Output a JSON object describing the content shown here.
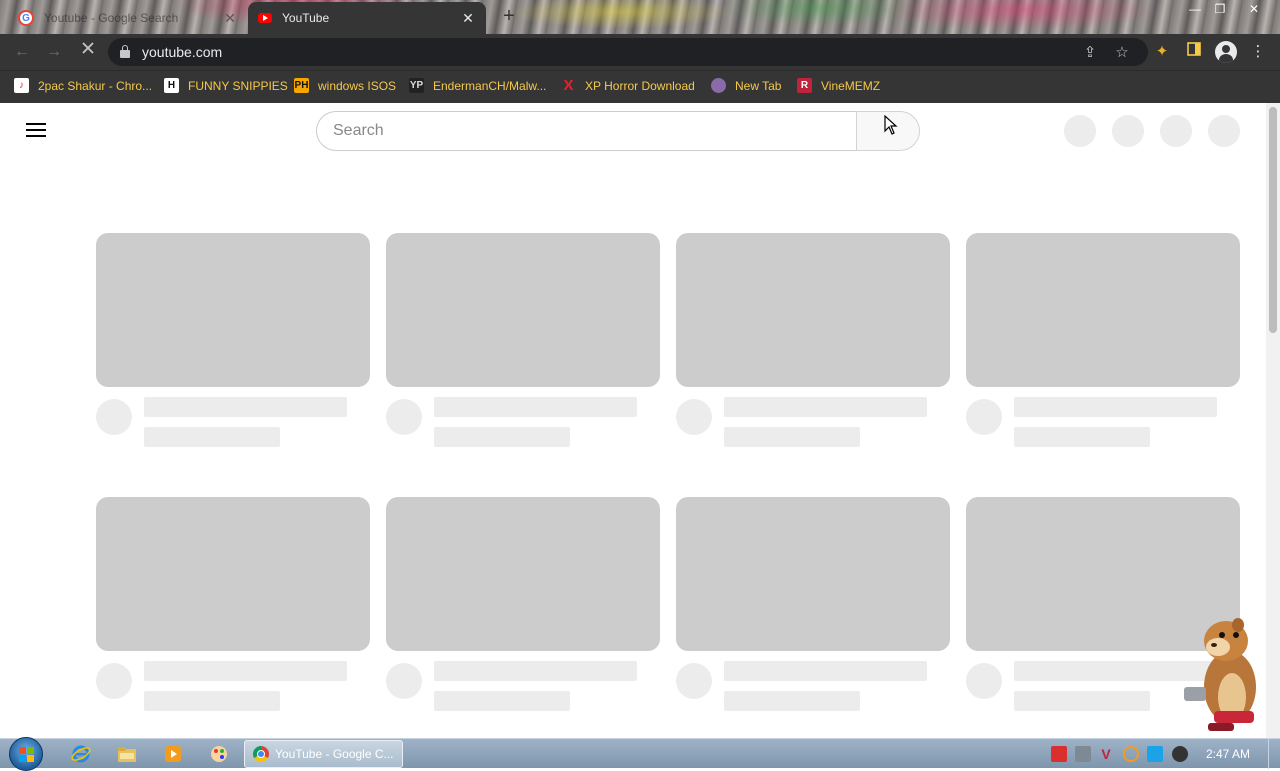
{
  "browser": {
    "tabs": [
      {
        "title": "Youtube - Google Search",
        "favicon": "google-icon",
        "active": false
      },
      {
        "title": "YouTube",
        "favicon": "youtube-icon",
        "active": true
      }
    ],
    "new_tab_symbol": "+",
    "close_symbol": "✕",
    "url": "youtube.com",
    "window_controls": {
      "minimize": "—",
      "maximize": "❐",
      "close": "✕"
    }
  },
  "bookmarks": [
    {
      "label": "2pac Shakur - Chro...",
      "icon": "music-icon",
      "color": "#d93025"
    },
    {
      "label": "FUNNY SNIPPIES",
      "icon": "h-letter-icon",
      "color": "#ffffff"
    },
    {
      "label": "windows ISOS",
      "icon": "ph-icon",
      "color": "#f7a600"
    },
    {
      "label": "EndermanCH/Malw...",
      "icon": "yp-icon",
      "color": "#444444"
    },
    {
      "label": "XP Horror Download",
      "icon": "x-icon",
      "color": "#e8212b"
    },
    {
      "label": "New Tab",
      "icon": "globe-icon",
      "color": "#8a6aa8"
    },
    {
      "label": "VineMEMZ",
      "icon": "r-icon",
      "color": "#c0243a"
    }
  ],
  "youtube": {
    "search_placeholder": "Search",
    "skeleton_rows": 2,
    "skeleton_columns": 4
  },
  "taskbar": {
    "active_window": "YouTube - Google C...",
    "clock": "2:47 AM"
  },
  "colors": {
    "chrome_dark": "#353535",
    "bookmark_text": "#f6c948",
    "skeleton_thumb": "#cccccc",
    "skeleton_line": "#ececec"
  }
}
